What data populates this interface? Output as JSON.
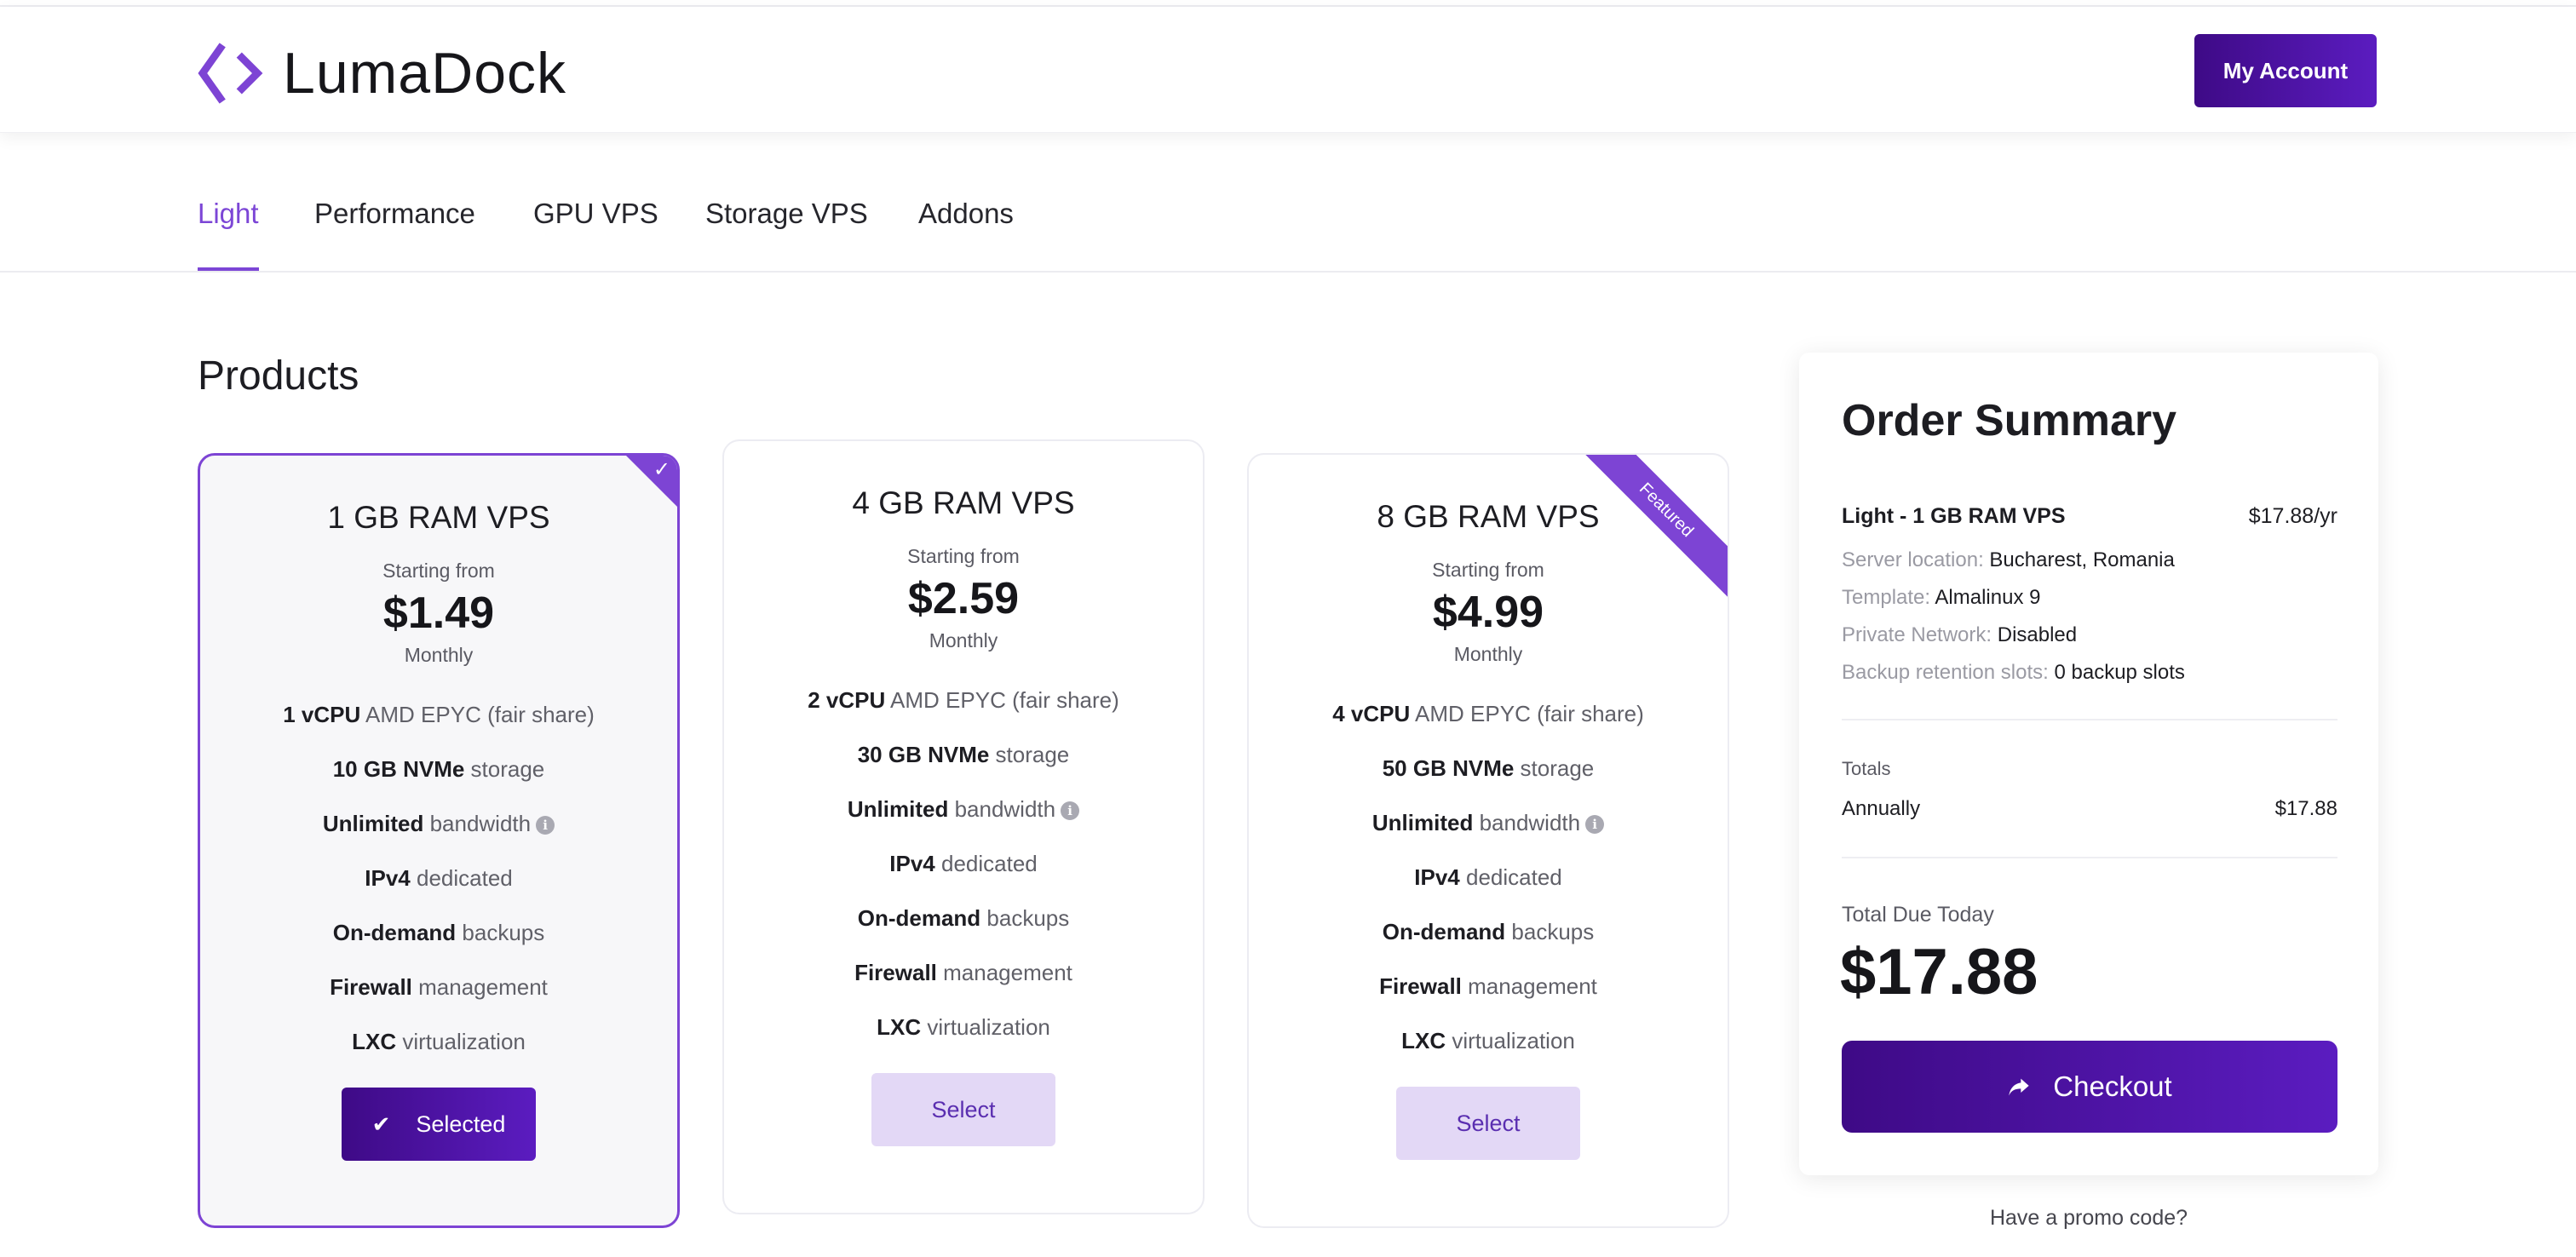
{
  "brand": {
    "name": "LumaDock",
    "accent": "#7d44d4",
    "button_gradient_start": "#3e0a86",
    "button_gradient_end": "#5b1cc0"
  },
  "header": {
    "account_label": "My Account"
  },
  "tabs": [
    {
      "label": "Light",
      "active": true
    },
    {
      "label": "Performance",
      "active": false
    },
    {
      "label": "GPU VPS",
      "active": false
    },
    {
      "label": "Storage VPS",
      "active": false
    },
    {
      "label": "Addons",
      "active": false
    }
  ],
  "products": {
    "title": "Products",
    "cards": [
      {
        "name": "1 GB RAM VPS",
        "from": "Starting from",
        "price": "$1.49",
        "cycle": "Monthly",
        "button_label": "Selected",
        "selected": true,
        "badge_icon": "check-icon",
        "features": [
          {
            "bold": "1 vCPU",
            "rest": "AMD EPYC (fair share)"
          },
          {
            "bold": "10 GB NVMe",
            "rest": "storage"
          },
          {
            "bold": "Unlimited",
            "rest": "bandwidth",
            "info_icon": true
          },
          {
            "bold": "IPv4",
            "rest": "dedicated"
          },
          {
            "bold": "On-demand",
            "rest": "backups"
          },
          {
            "bold": "Firewall",
            "rest": "management"
          },
          {
            "bold": "LXC",
            "rest": "virtualization"
          }
        ]
      },
      {
        "name": "4 GB RAM VPS",
        "from": "Starting from",
        "price": "$2.59",
        "cycle": "Monthly",
        "button_label": "Select",
        "selected": false,
        "features": [
          {
            "bold": "2 vCPU",
            "rest": "AMD EPYC (fair share)"
          },
          {
            "bold": "30 GB NVMe",
            "rest": "storage"
          },
          {
            "bold": "Unlimited",
            "rest": "bandwidth",
            "info_icon": true
          },
          {
            "bold": "IPv4",
            "rest": "dedicated"
          },
          {
            "bold": "On-demand",
            "rest": "backups"
          },
          {
            "bold": "Firewall",
            "rest": "management"
          },
          {
            "bold": "LXC",
            "rest": "virtualization"
          }
        ]
      },
      {
        "name": "8 GB RAM VPS",
        "from": "Starting from",
        "price": "$4.99",
        "cycle": "Monthly",
        "button_label": "Select",
        "selected": false,
        "ribbon": "Featured",
        "features": [
          {
            "bold": "4 vCPU",
            "rest": "AMD EPYC (fair share)"
          },
          {
            "bold": "50 GB NVMe",
            "rest": "storage"
          },
          {
            "bold": "Unlimited",
            "rest": "bandwidth",
            "info_icon": true
          },
          {
            "bold": "IPv4",
            "rest": "dedicated"
          },
          {
            "bold": "On-demand",
            "rest": "backups"
          },
          {
            "bold": "Firewall",
            "rest": "management"
          },
          {
            "bold": "LXC",
            "rest": "virtualization"
          }
        ]
      }
    ]
  },
  "summary": {
    "title": "Order Summary",
    "product": "Light - 1 GB RAM VPS",
    "product_price": "$17.88/yr",
    "details": [
      {
        "label": "Server location:",
        "value": "Bucharest, Romania"
      },
      {
        "label": "Template:",
        "value": "Almalinux 9"
      },
      {
        "label": "Private Network:",
        "value": "Disabled"
      },
      {
        "label": "Backup retention slots:",
        "value": "0 backup slots"
      }
    ],
    "totals_label": "Totals",
    "annually_label": "Annually",
    "annually_value": "$17.88",
    "due_label": "Total Due Today",
    "due_value": "$17.88",
    "checkout_label": "Checkout"
  },
  "promo_label": "Have a promo code?"
}
